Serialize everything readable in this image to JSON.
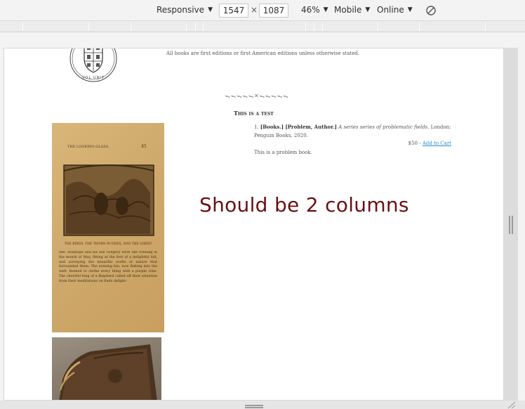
{
  "devtools": {
    "device": "Responsive",
    "width": "1547",
    "times": "×",
    "height": "1087",
    "zoom": "46%",
    "throttle_profile": "Mobile",
    "network": "Online"
  },
  "page": {
    "notice": "All books are first editions or first American editions unless otherwise stated.",
    "ornament": "ᯓᯓᯓᯓᯓ✕ᯓᯓᯓᯓᯓ",
    "section_title": "This is a test",
    "entry": {
      "number": "1.",
      "tags": "[Books.] [Problem, Author.]",
      "title": "A series series of problematic fields.",
      "publisher": "London: Penguin Books, 2020."
    },
    "price": "$50 -",
    "add_to_cart": "Add to Cart",
    "description": "This is a problem book."
  },
  "annotation": "Should be 2 columns",
  "book_image": {
    "header": "THE LOOKING-GLASS.",
    "page_number": "45",
    "caption": "THE BIRDS, THE THORN-BUSHES, AND THE SHEEP.",
    "body": "MR. Stanhope and his son Gregory were one evening in the month of May, fitting at the foot of a delightful hill, and surveying the beautiful works of nature that furrounded them. The evening fun, now finking into the weft, feemed to clothe every thing with a purple robe. The cheerful fong of a fhepherd called off their attention from their meditations on thefe delight-"
  },
  "logo_text": "VOL UNIT"
}
